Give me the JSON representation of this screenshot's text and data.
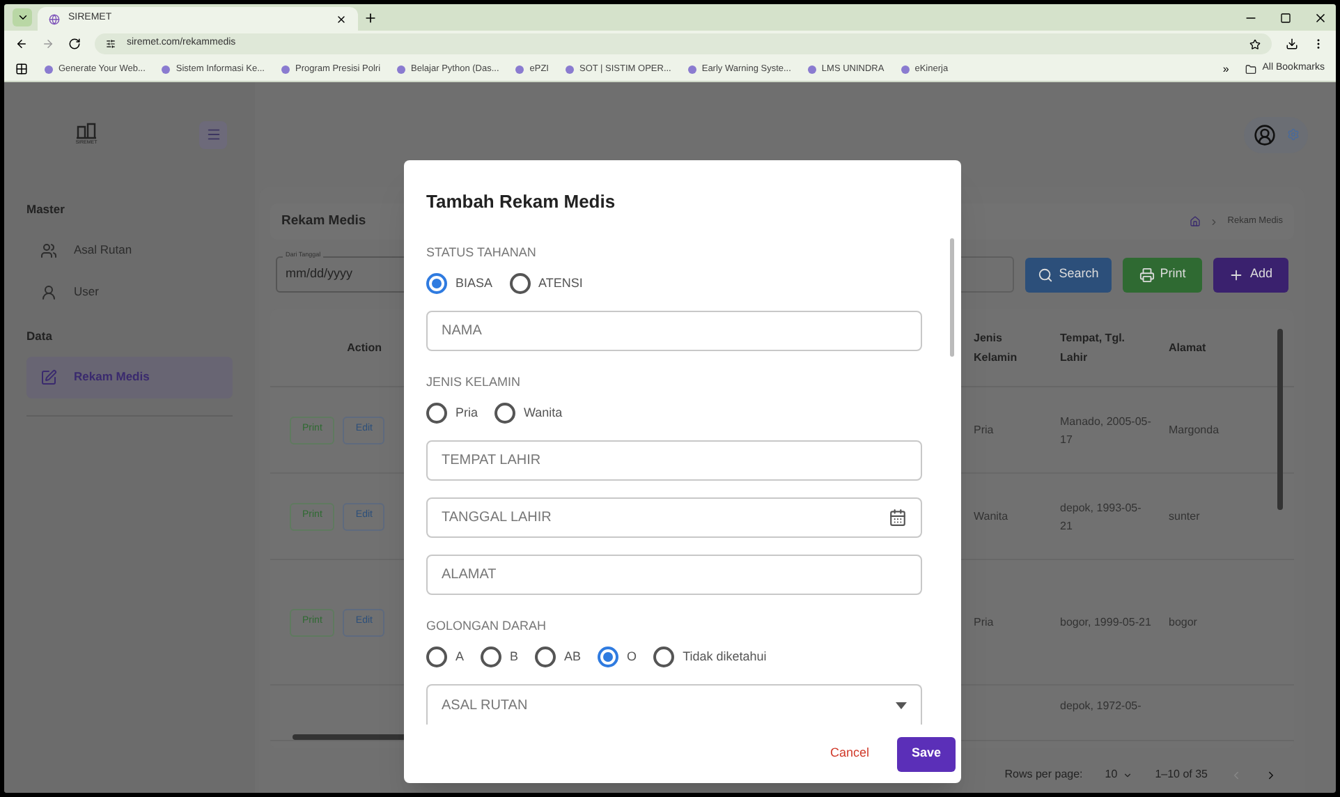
{
  "browser": {
    "tabs": [
      {
        "title": "SIREMET",
        "selected": true
      }
    ],
    "url": "siremet.com/rekammedis",
    "bookmarks": [
      "Generate Your Web...",
      "Sistem Informasi Ke...",
      "Program Presisi Polri",
      "Belajar Python (Das...",
      "ePZI",
      "SOT | SISTIM OPER...",
      "Early Warning Syste...",
      "LMS UNINDRA",
      "eKinerja"
    ],
    "more": "»",
    "all_bookmarks": "All Bookmarks"
  },
  "app": {
    "logo_text": "SIREMET",
    "sidebar": [
      {
        "heading": "Master",
        "items": [
          {
            "label": "Asal Rutan",
            "selected": false
          },
          {
            "label": "User",
            "selected": false
          }
        ]
      },
      {
        "heading": "Data",
        "items": [
          {
            "label": "Rekam Medis",
            "selected": true
          }
        ]
      }
    ],
    "page_title": "Rekam Medis",
    "breadcrumb": [
      "Rekam Medis"
    ],
    "date_filter": {
      "label": "Dari Tanggal",
      "placeholder": "mm/dd/yyyy"
    },
    "buttons": [
      {
        "label": "Search",
        "kind": "search"
      },
      {
        "label": "Print",
        "kind": "print"
      },
      {
        "label": "Add",
        "kind": "add"
      }
    ],
    "table": {
      "columns": [
        "Action",
        "Jenis Kelamin",
        "Tempat, Tgl. Lahir",
        "Alamat"
      ],
      "rows": [
        {
          "actions": [
            "Print",
            "Edit"
          ],
          "jenis_kelamin": "Pria",
          "tempat_tgl_lahir": "Manado, 2005-05-17",
          "alamat": "Margonda"
        },
        {
          "actions": [
            "Print",
            "Edit"
          ],
          "jenis_kelamin": "Wanita",
          "tempat_tgl_lahir": "depok, 1993-05-21",
          "alamat": "sunter"
        },
        {
          "actions": [
            "Print",
            "Edit"
          ],
          "jenis_kelamin": "Pria",
          "tempat_tgl_lahir": "bogor, 1999-05-21",
          "alamat": "bogor"
        },
        {
          "actions": [],
          "jenis_kelamin": "",
          "tempat_tgl_lahir": "depok, 1972-05-",
          "alamat": ""
        }
      ]
    },
    "pagination": {
      "rows_per_page_label": "Rows per page:",
      "rows_per_page": "10",
      "range": "1–10 of 35"
    }
  },
  "modal": {
    "title": "Tambah Rekam Medis",
    "fields": [
      {
        "kind": "radio",
        "label": "STATUS TAHANAN",
        "options": [
          {
            "label": "BIASA",
            "selected": true
          },
          {
            "label": "ATENSI",
            "selected": false
          }
        ]
      },
      {
        "kind": "text",
        "placeholder": "NAMA"
      },
      {
        "kind": "radio",
        "label": "JENIS KELAMIN",
        "options": [
          {
            "label": "Pria",
            "selected": false
          },
          {
            "label": "Wanita",
            "selected": false
          }
        ]
      },
      {
        "kind": "text",
        "placeholder": "TEMPAT LAHIR"
      },
      {
        "kind": "date",
        "placeholder": "TANGGAL LAHIR"
      },
      {
        "kind": "text",
        "placeholder": "ALAMAT"
      },
      {
        "kind": "radio",
        "label": "GOLONGAN DARAH",
        "options": [
          {
            "label": "A",
            "selected": false
          },
          {
            "label": "B",
            "selected": false
          },
          {
            "label": "AB",
            "selected": false
          },
          {
            "label": "O",
            "selected": true
          },
          {
            "label": "Tidak diketahui",
            "selected": false
          }
        ]
      },
      {
        "kind": "select",
        "placeholder": "ASAL RUTAN"
      }
    ],
    "cancel": "Cancel",
    "save": "Save"
  }
}
